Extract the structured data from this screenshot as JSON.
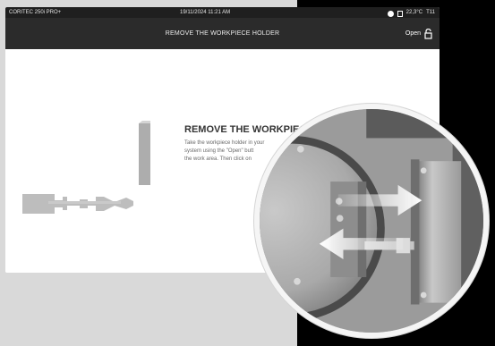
{
  "status_bar": {
    "device_name": "CORITEC 250i PRO+",
    "datetime": "19/11/2024 11:21 AM",
    "temperature": "22,3°C",
    "status_code": "T11"
  },
  "header": {
    "title": "REMOVE THE WORKPIECE HOLDER",
    "open_label": "Open"
  },
  "instruction": {
    "title": "REMOVE THE WORKPIECE",
    "text_line_1": "Take the workpiece holder in your",
    "text_line_2": "system using the \"Open\" butt",
    "text_line_3": "the work area. Then click on"
  },
  "icons": {
    "status_dot": "circle-icon",
    "battery": "battery-icon",
    "open": "unlock-icon"
  },
  "colors": {
    "gray_background": "#d9d9d9",
    "dark_header": "#2b2b2b",
    "black_background": "#000000"
  }
}
